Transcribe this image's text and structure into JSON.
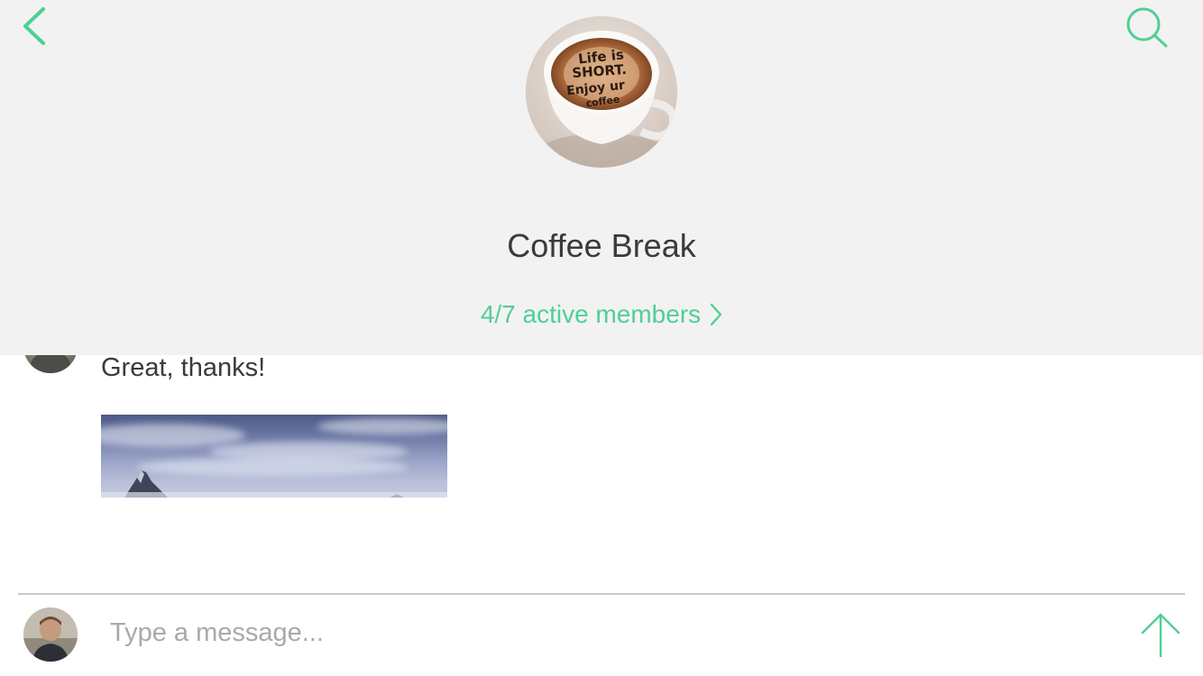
{
  "header": {
    "group_name": "Coffee Break",
    "members_link": "4/7 active members",
    "avatar_text": "Life is SHORT. Enjoy ur coffee",
    "icons": {
      "back": "chevron-left-icon",
      "search": "search-icon",
      "members_chevron": "chevron-right-icon"
    }
  },
  "messages": [
    {
      "text": "Great, thanks!",
      "has_image": true,
      "image_subject": "mountain-photo"
    }
  ],
  "composer": {
    "placeholder": "Type a message...",
    "value": "",
    "send_icon": "arrow-up-icon"
  },
  "colors": {
    "accent": "#4fcf95",
    "header_bg": "#f2f2f2",
    "text": "#3a3a3a",
    "placeholder": "#a9a9a9"
  }
}
